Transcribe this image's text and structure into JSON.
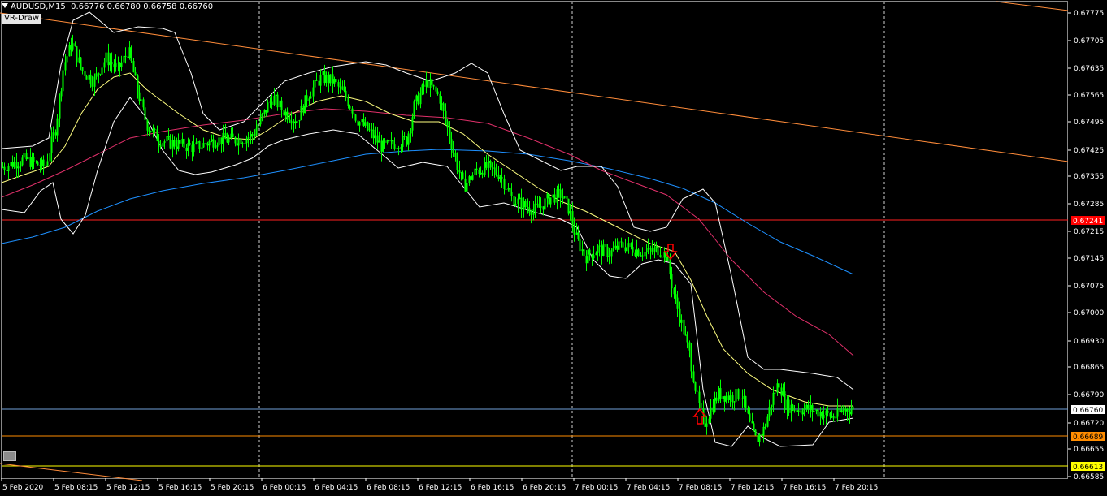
{
  "header": {
    "symbol": "AUDUSD,M15",
    "quotes": "0.66776 0.66780 0.66758 0.66760"
  },
  "indicator_button": "VR-Draw",
  "y_axis": {
    "ticks": [
      "0.67775",
      "0.67705",
      "0.67635",
      "0.67565",
      "0.67495",
      "0.67425",
      "0.67355",
      "0.67285",
      "0.67215",
      "0.67145",
      "0.67075",
      "0.67000",
      "0.66930",
      "0.66865",
      "0.66790",
      "0.66720",
      "0.66655",
      "0.66585"
    ]
  },
  "x_axis": {
    "ticks": [
      "5 Feb 2020",
      "5 Feb 08:15",
      "5 Feb 12:15",
      "5 Feb 16:15",
      "5 Feb 20:15",
      "6 Feb 00:15",
      "6 Feb 04:15",
      "6 Feb 08:15",
      "6 Feb 12:15",
      "6 Feb 16:15",
      "6 Feb 20:15",
      "7 Feb 00:15",
      "7 Feb 04:15",
      "7 Feb 08:15",
      "7 Feb 12:15",
      "7 Feb 16:15",
      "7 Feb 20:15"
    ]
  },
  "price_tags": [
    {
      "label": "0.67241",
      "bg": "#ff0000",
      "fg": "#ffffff",
      "line": "#ff2020"
    },
    {
      "label": "0.66760",
      "bg": "#ffffff",
      "fg": "#000000",
      "line": "#6f9fd8"
    },
    {
      "label": "0.66689",
      "bg": "#ff8c00",
      "fg": "#000000",
      "line": "#ff8c00"
    },
    {
      "label": "0.66613",
      "bg": "#ffff00",
      "fg": "#000000",
      "line": "#ffff00"
    }
  ],
  "colors": {
    "background": "#000000",
    "candles": "#00ff00",
    "bollinger": "#ffffff",
    "ma_fast": "#ffff80",
    "ma_mid": "#e0306a",
    "ma_slow": "#1e90ff",
    "trendline": "#ff8c3a",
    "arrow": "#ff0000"
  }
}
